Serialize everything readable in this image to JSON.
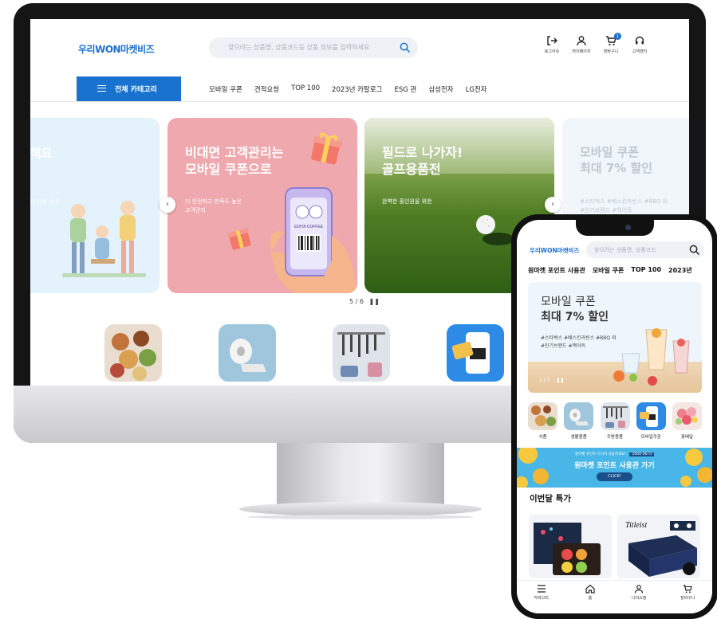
{
  "desktop": {
    "logo": "우리WON마켓비즈",
    "search": {
      "placeholder": "찾으려는 상품명, 상품코드등 상품 정보를 입력하세요"
    },
    "utility": [
      {
        "icon": "login-icon",
        "label": "로그아웃"
      },
      {
        "icon": "user-icon",
        "label": "마이페이지"
      },
      {
        "icon": "cart-icon",
        "label": "장바구니",
        "badge": "1"
      },
      {
        "icon": "headset-icon",
        "label": "고객센터"
      }
    ],
    "category_button": "전체 카테고리",
    "nav": [
      "모바일 쿠폰",
      "견적요청",
      "TOP 100",
      "2023년 카탈로그",
      "ESG 관",
      "삼성전자",
      "LG전자"
    ],
    "banners": [
      {
        "title": "해요",
        "sub": "더 나은 세상"
      },
      {
        "title": "비대면 고객관리는\n모바일 쿠폰으로",
        "sub": "더 안전하고 만족도 높은\n고객관리",
        "coupon_brand": "EDIYA COFFEE"
      },
      {
        "title": "필드로 나가자!\n골프용품전",
        "sub": "완벽한 홀인원을 위한"
      },
      {
        "title": "모바일 쿠폰\n최대 7% 할인",
        "sub": "#스타벅스 #배스킨라빈스 #BBQ 외\n#인기브랜드 #핵이득"
      }
    ],
    "pager": "5 / 6"
  },
  "mobile": {
    "logo": "우리WON마켓비즈",
    "search": {
      "placeholder": "찾으려는 상품명, 상품코드"
    },
    "nav": [
      "원마켓 포인트 사용관",
      "모바일 쿠폰",
      "TOP 100",
      "2023년"
    ],
    "banner": {
      "title_1": "모바일 쿠폰",
      "title_2": "최대 7% 할인",
      "tags_1": "#스타벅스 #배스킨라빈스 #BBQ 외",
      "tags_2": "#인기브랜드 #핵이득",
      "pager": "1 / 7"
    },
    "categories": [
      "식품",
      "생활용품",
      "주방용품",
      "모바일쿠폰",
      "꽃배달"
    ],
    "promo": {
      "small": "원마켓 포인트 이거서 사용하세요!",
      "phone": "1600-3673",
      "title": "원마켓 포인트 사용관 가기",
      "cta": "CLICK!"
    },
    "section_title": "이번달 특가",
    "product_brand": "Titleist",
    "tabs": [
      {
        "icon": "menu-icon",
        "label": "카테고리"
      },
      {
        "icon": "home-icon",
        "label": "홈"
      },
      {
        "icon": "user-icon",
        "label": "나의쇼핑"
      },
      {
        "icon": "cart-icon",
        "label": "장바구니"
      }
    ]
  },
  "colors": {
    "brand": "#1b6fd1",
    "category_button": "#1a72cf",
    "coupon_banner": "#eea8ae",
    "promo": "#48b6e6"
  }
}
